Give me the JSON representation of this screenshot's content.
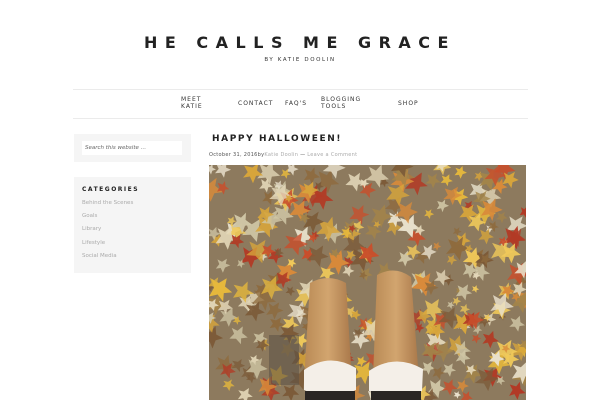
{
  "site": {
    "title": "HE CALLS ME GRACE",
    "byline": "BY KATIE DOOLIN"
  },
  "nav": {
    "items": [
      {
        "line1": "MEET",
        "line2": "KATIE"
      },
      {
        "line1": "CONTACT",
        "line2": ""
      },
      {
        "line1": "FAQ'S",
        "line2": ""
      },
      {
        "line1": "BLOGGING",
        "line2": "TOOLS"
      },
      {
        "line1": "SHOP",
        "line2": ""
      }
    ]
  },
  "sidebar": {
    "search": {
      "placeholder": "Search this website …"
    },
    "categories": {
      "heading": "CATEGORIES",
      "items": [
        "Behind the Scenes",
        "Goals",
        "Library",
        "Lifestyle",
        "Social Media"
      ]
    }
  },
  "post": {
    "title": "HAPPY HALLOWEEN!",
    "date": "October 31, 2016",
    "by": "by",
    "author": "Katie Doolin",
    "separator": " — ",
    "comments": "Leave a Comment"
  }
}
